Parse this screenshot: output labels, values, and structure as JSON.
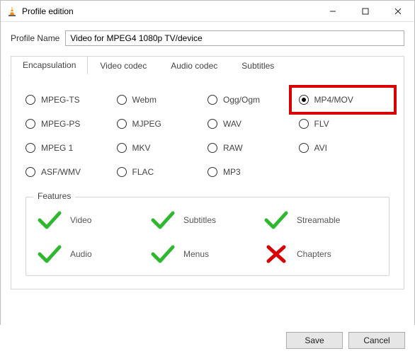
{
  "window": {
    "title": "Profile edition",
    "min": "—",
    "max": "☐",
    "close": "✕"
  },
  "profile_name": {
    "label": "Profile Name",
    "value": "Video for MPEG4 1080p TV/device"
  },
  "tabs": {
    "encapsulation": "Encapsulation",
    "video_codec": "Video codec",
    "audio_codec": "Audio codec",
    "subtitles": "Subtitles",
    "active": "encapsulation"
  },
  "radios": {
    "r0": {
      "label": "MPEG-TS",
      "checked": false
    },
    "r1": {
      "label": "Webm",
      "checked": false
    },
    "r2": {
      "label": "Ogg/Ogm",
      "checked": false
    },
    "r3": {
      "label": "MP4/MOV",
      "checked": true,
      "highlight": true
    },
    "r4": {
      "label": "MPEG-PS",
      "checked": false
    },
    "r5": {
      "label": "MJPEG",
      "checked": false
    },
    "r6": {
      "label": "WAV",
      "checked": false
    },
    "r7": {
      "label": "FLV",
      "checked": false
    },
    "r8": {
      "label": "MPEG 1",
      "checked": false
    },
    "r9": {
      "label": "MKV",
      "checked": false
    },
    "r10": {
      "label": "RAW",
      "checked": false
    },
    "r11": {
      "label": "AVI",
      "checked": false
    },
    "r12": {
      "label": "ASF/WMV",
      "checked": false
    },
    "r13": {
      "label": "FLAC",
      "checked": false
    },
    "r14": {
      "label": "MP3",
      "checked": false
    }
  },
  "features": {
    "legend": "Features",
    "video": {
      "label": "Video",
      "ok": true
    },
    "subtitles": {
      "label": "Subtitles",
      "ok": true
    },
    "streamable": {
      "label": "Streamable",
      "ok": true
    },
    "audio": {
      "label": "Audio",
      "ok": true
    },
    "menus": {
      "label": "Menus",
      "ok": true
    },
    "chapters": {
      "label": "Chapters",
      "ok": false
    }
  },
  "buttons": {
    "save": "Save",
    "cancel": "Cancel"
  }
}
